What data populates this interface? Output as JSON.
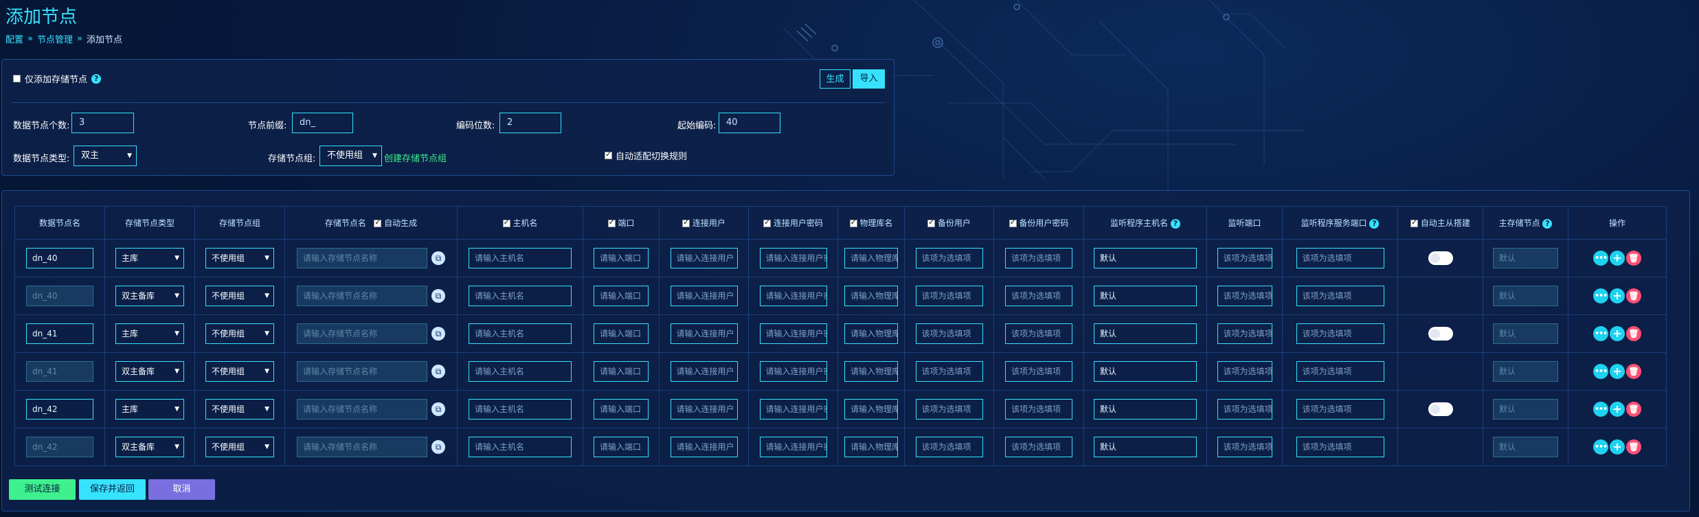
{
  "page": {
    "title": "添加节点"
  },
  "breadcrumb": [
    "配置",
    "节点管理",
    "添加节点"
  ],
  "top_form": {
    "storage_only_label": "仅添加存储节点",
    "generate_btn": "生成",
    "import_btn": "导入",
    "count_label": "数据节点个数:",
    "count_value": "3",
    "prefix_label": "节点前缀:",
    "prefix_value": "dn_",
    "digits_label": "编码位数:",
    "digits_value": "2",
    "start_label": "起始编码:",
    "start_value": "40",
    "type_label": "数据节点类型:",
    "type_value": "双主",
    "group_label": "存储节点组:",
    "group_value": "不使用组",
    "create_group_link": "创建存储节点组",
    "auto_switch_label": "自动适配切换规则"
  },
  "table": {
    "headers": [
      "数据节点名",
      "存储节点类型",
      "存储节点组",
      "存储节点名",
      "自动生成",
      "主机名",
      "端口",
      "连接用户",
      "连接用户密码",
      "物理库名",
      "备份用户",
      "备份用户密码",
      "监听程序主机名",
      "监听端口",
      "监听程序服务端口",
      "自动主从搭建",
      "主存储节点",
      "操作"
    ],
    "placeholders": {
      "storage_name": "请输入存储节点名称",
      "host": "请输入主机名",
      "port": "请输入端口",
      "user": "请输入连接用户",
      "password": "请输入连接用户密码",
      "db": "请输入物理库名",
      "optional": "该项为选填项",
      "listener_host": "默认",
      "master": "默认"
    },
    "group_value": "不使用组",
    "rows": [
      {
        "name": "dn_40",
        "type": "主库",
        "primary": true
      },
      {
        "name": "dn_40",
        "type": "双主备库",
        "primary": false
      },
      {
        "name": "dn_41",
        "type": "主库",
        "primary": true
      },
      {
        "name": "dn_41",
        "type": "双主备库",
        "primary": false
      },
      {
        "name": "dn_42",
        "type": "主库",
        "primary": true
      },
      {
        "name": "dn_42",
        "type": "双主备库",
        "primary": false
      }
    ]
  },
  "buttons": {
    "test": "测试连接",
    "save": "保存并返回",
    "cancel": "取消"
  },
  "colors": {
    "accent": "#37e2ff",
    "test_btn": "#3ef08e",
    "cancel_btn": "#7a6fe0",
    "delete": "#ff4f73"
  }
}
